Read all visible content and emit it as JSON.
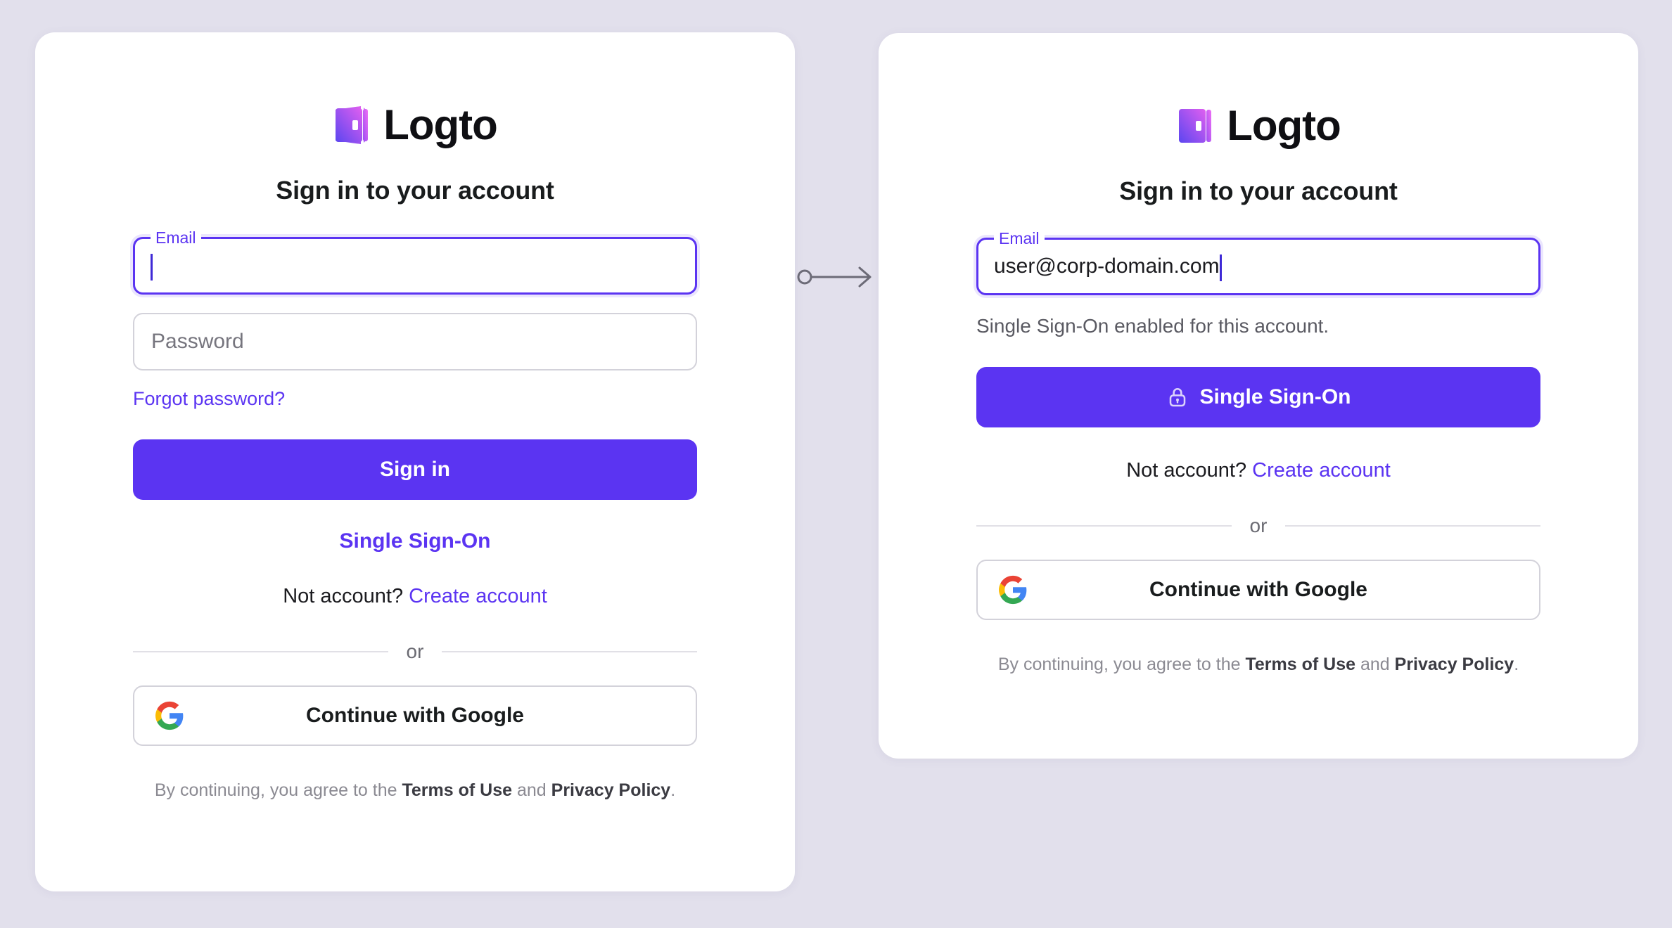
{
  "theme": {
    "background": "#e2e0ec",
    "card_background": "#ffffff",
    "accent": "#5b34f2",
    "text_primary": "#191c1d",
    "text_muted": "#76757e",
    "border": "#d3d2da"
  },
  "brand": {
    "name": "Logto",
    "logo_icon": "logto-door-logo",
    "logo_gradient_from": "#5b46f0",
    "logo_gradient_to": "#e05ff0"
  },
  "connector": {
    "icon": "arrow-right-from-dot-icon"
  },
  "left_card": {
    "heading": "Sign in to your account",
    "email_field": {
      "label": "Email",
      "value": "",
      "placeholder": "",
      "focused": true
    },
    "password_field": {
      "placeholder": "Password",
      "value": ""
    },
    "forgot_password_label": "Forgot password?",
    "sign_in_label": "Sign in",
    "sso_link_label": "Single Sign-On",
    "create_account_prefix": "Not account?",
    "create_account_label": "Create account",
    "divider_label": "or",
    "google_label": "Continue with Google",
    "google_icon": "google-g-icon",
    "terms": {
      "prefix": "By continuing, you agree to the",
      "terms_label": "Terms of Use",
      "conjunction": "and",
      "privacy_label": "Privacy Policy",
      "suffix": "."
    }
  },
  "right_card": {
    "heading": "Sign in to your account",
    "email_field": {
      "label": "Email",
      "value": "user@corp-domain.com",
      "focused": true
    },
    "sso_notice": "Single Sign-On enabled for this account.",
    "sso_button_label": "Single Sign-On",
    "sso_button_icon": "lock-icon",
    "create_account_prefix": "Not account?",
    "create_account_label": "Create account",
    "divider_label": "or",
    "google_label": "Continue with Google",
    "google_icon": "google-g-icon",
    "terms": {
      "prefix": "By continuing, you agree to the",
      "terms_label": "Terms of Use",
      "conjunction": "and",
      "privacy_label": "Privacy Policy",
      "suffix": "."
    }
  }
}
